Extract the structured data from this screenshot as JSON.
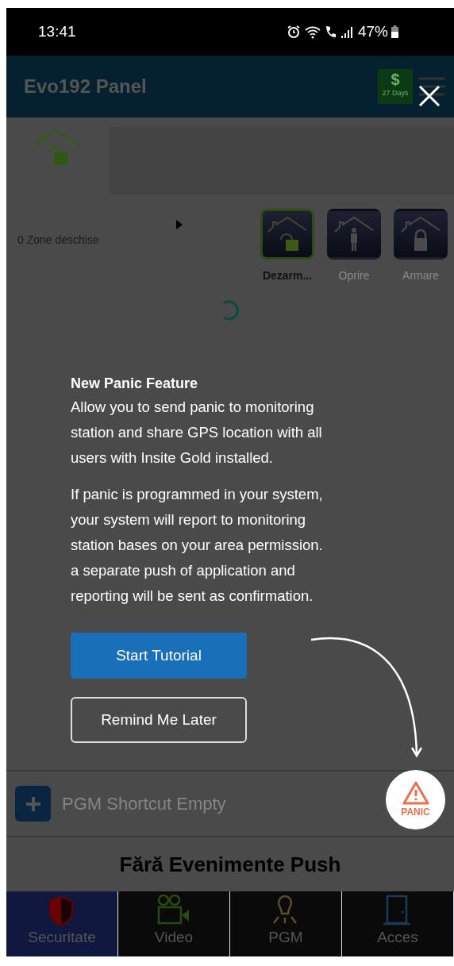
{
  "status_bar": {
    "time": "13:41",
    "battery": "47%"
  },
  "app_bar": {
    "title": "Evo192 Panel",
    "badge": {
      "symbol": "$",
      "days": "27 Days"
    }
  },
  "zones": {
    "open_zones": "0 Zone deschise"
  },
  "modes": [
    {
      "label": "Dezarm...",
      "kind": "disarm",
      "selected": true
    },
    {
      "label": "Oprire",
      "kind": "stay",
      "selected": false
    },
    {
      "label": "Armare",
      "kind": "arm",
      "selected": false
    }
  ],
  "tutorial": {
    "title": "New Panic Feature",
    "paragraphs": [
      "Allow you to send panic to monitoring station and share GPS location with all users with Insite Gold installed.",
      "If panic is programmed in your system, your system will report to monitoring station bases on your area permission. a separate push of application and reporting will be sent as confirmation."
    ],
    "buttons": [
      {
        "label": "Start Tutorial",
        "kind": "primary"
      },
      {
        "label": "Remind Me Later",
        "kind": "outline"
      }
    ]
  },
  "pgm_shortcut": {
    "label": "PGM Shortcut Empty"
  },
  "panic_button": {
    "label": "PANIC"
  },
  "push_events": {
    "message": "Fără Evenimente Push"
  },
  "bottom_tabs": [
    {
      "label": "Securitate",
      "kind": "security",
      "selected": true
    },
    {
      "label": "Video",
      "kind": "video",
      "selected": false
    },
    {
      "label": "PGM",
      "kind": "pgm",
      "selected": false
    },
    {
      "label": "Acces",
      "kind": "access",
      "selected": false
    }
  ]
}
